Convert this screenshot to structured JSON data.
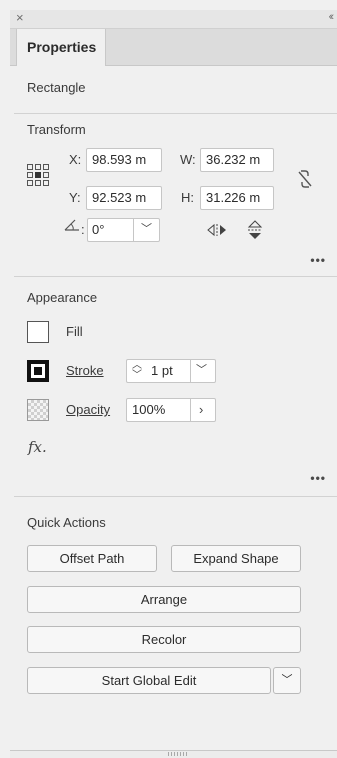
{
  "window": {
    "close_symbol": "×",
    "collapse_symbol": "‹‹"
  },
  "tab": {
    "label": "Properties"
  },
  "object_type": "Rectangle",
  "transform": {
    "title": "Transform",
    "x_label": "X:",
    "x_value": "98.593 m",
    "y_label": "Y:",
    "y_value": "92.523 m",
    "w_label": "W:",
    "w_value": "36.232 m",
    "h_label": "H:",
    "h_value": "31.226 m",
    "angle_value": "0°",
    "icons": [
      "reference-point-icon",
      "link-proportions-icon",
      "angle-icon",
      "flip-horizontal-icon",
      "flip-vertical-icon"
    ]
  },
  "appearance": {
    "title": "Appearance",
    "fill_label": "Fill",
    "stroke_label": "Stroke",
    "stroke_weight": "1 pt",
    "opacity_label": "Opacity",
    "opacity_value": "100%",
    "fx_label": "fx."
  },
  "quick_actions": {
    "title": "Quick Actions",
    "offset_path": "Offset Path",
    "expand_shape": "Expand Shape",
    "arrange": "Arrange",
    "recolor": "Recolor",
    "start_global_edit": "Start Global Edit"
  },
  "more_symbol": "•••",
  "colors": {
    "panel_bg": "#f0f0f0",
    "field_bg": "#ffffff",
    "border": "#c6c6c6",
    "text": "#323232"
  }
}
